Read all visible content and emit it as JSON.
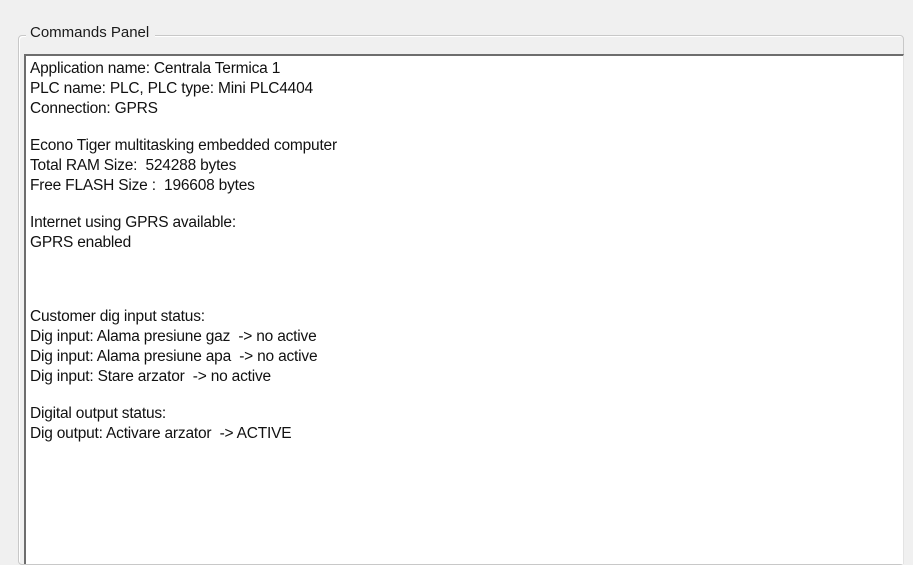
{
  "panel": {
    "title": "Commands Panel"
  },
  "log": {
    "lines": [
      "Application name: Centrala Termica 1",
      "PLC name: PLC, PLC type: Mini PLC4404",
      "Connection: GPRS",
      "",
      "Econo Tiger multitasking embedded computer",
      "Total RAM Size:  524288 bytes",
      "Free FLASH Size :  196608 bytes",
      "",
      "Internet using GPRS available:",
      "GPRS enabled",
      "",
      "",
      "Customer dig input status:",
      "Dig input: Alama presiune gaz  -> no active",
      "Dig input: Alama presiune apa  -> no active",
      "Dig input: Stare arzator  -> no active",
      "",
      "Digital output status:",
      "Dig output: Activare arzator  -> ACTIVE"
    ]
  }
}
